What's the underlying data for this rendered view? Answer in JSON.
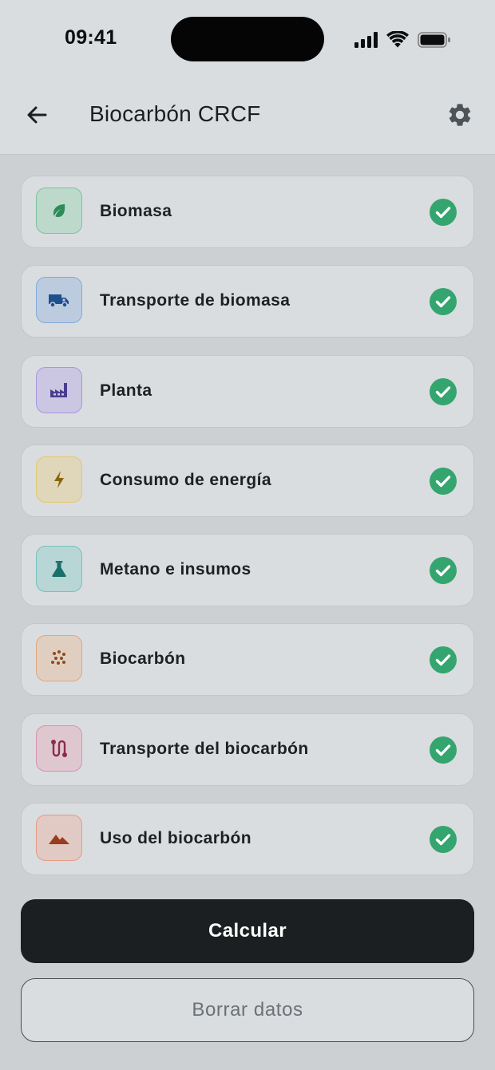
{
  "status_bar": {
    "time": "09:41",
    "icons": [
      "cellular-signal-icon",
      "wifi-icon",
      "battery-icon"
    ]
  },
  "header": {
    "back_icon": "arrow-left-icon",
    "title": "Biocarbón CRCF",
    "settings_icon": "gear-icon"
  },
  "sections": [
    {
      "label": "Biomasa",
      "icon": "leaf-icon",
      "color": "#2e8b57",
      "bg": "#bcd9cc",
      "border": "#7cc3a0",
      "completed": true
    },
    {
      "label": "Transporte de biomasa",
      "icon": "truck-icon",
      "color": "#1f4f8f",
      "bg": "#bccbde",
      "border": "#7faadf",
      "completed": true
    },
    {
      "label": "Planta",
      "icon": "factory-icon",
      "color": "#4b3c8e",
      "bg": "#cbc6e2",
      "border": "#a796e0",
      "completed": true
    },
    {
      "label": "Consumo de energía",
      "icon": "lightning-bolt-icon",
      "color": "#8a6410",
      "bg": "#e0d6b9",
      "border": "#e2c776",
      "completed": true
    },
    {
      "label": "Metano e insumos",
      "icon": "flask-icon",
      "color": "#196f6a",
      "bg": "#b8d6d6",
      "border": "#73c2bf",
      "completed": true
    },
    {
      "label": "Biocarbón",
      "icon": "dots-grid-icon",
      "color": "#8c4a1e",
      "bg": "#e0cfc0",
      "border": "#e0a77c",
      "completed": true
    },
    {
      "label": "Transporte del biocarbón",
      "icon": "route-icon",
      "color": "#8a2d4a",
      "bg": "#dfc7d0",
      "border": "#d792ac",
      "completed": true
    },
    {
      "label": "Uso del biocarbón",
      "icon": "mountain-icon",
      "color": "#9a3b22",
      "bg": "#e1cac3",
      "border": "#e59a85",
      "completed": true
    }
  ],
  "check_icon": "check-circle-icon",
  "check_color": "#34a56f",
  "actions": {
    "primary_label": "Calcular",
    "secondary_label": "Borrar datos"
  }
}
